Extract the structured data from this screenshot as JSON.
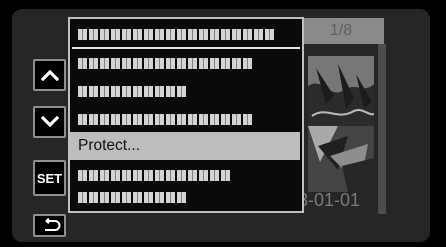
{
  "counter": {
    "text": "1/8"
  },
  "date": {
    "text": "8-01-01"
  },
  "controls": {
    "up_icon": "chevron-up",
    "down_icon": "chevron-down",
    "set_label": "SET",
    "back_icon": "return-arrow"
  },
  "menu": {
    "items": [
      {
        "label": "",
        "obscured": true
      },
      {
        "label": "",
        "obscured": true
      },
      {
        "label": "",
        "obscured": true
      },
      {
        "label": "",
        "obscured": true
      },
      {
        "label": "Protect...",
        "obscured": false,
        "selected": true
      },
      {
        "label": "",
        "obscured": true
      },
      {
        "label": "",
        "obscured": true
      }
    ]
  },
  "colors": {
    "selection": "#bdbdbd",
    "menu_border": "#bfbfbf",
    "lcd_background": "#262626"
  }
}
